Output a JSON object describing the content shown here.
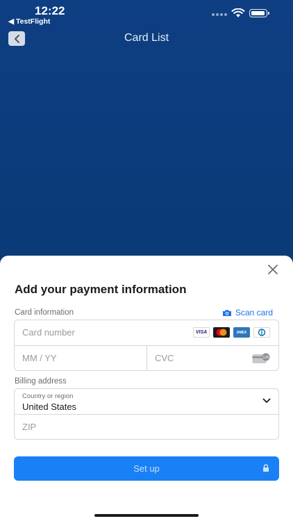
{
  "status_bar": {
    "time": "12:22",
    "back_app": "◀ TestFlight"
  },
  "nav": {
    "title": "Card List",
    "back_icon": "chevron-left-icon"
  },
  "sheet": {
    "title": "Add your payment information",
    "card_info_label": "Card information",
    "scan_card_label": "Scan card",
    "card_number_placeholder": "Card number",
    "expiry_placeholder": "MM / YY",
    "cvc_placeholder": "CVC",
    "cvc_icon_text": "135",
    "brands": [
      "VISA",
      "Mastercard",
      "AMERICAN EXPRESS",
      "Diners Club"
    ],
    "visa_label": "VISA",
    "amex_label": "AMEX",
    "billing_label": "Billing address",
    "country_label": "Country or region",
    "country_value": "United States",
    "zip_placeholder": "ZIP",
    "setup_button": "Set up"
  },
  "colors": {
    "primary": "#1a80f5",
    "background": "#0b3d7f",
    "link": "#1a73e8"
  }
}
